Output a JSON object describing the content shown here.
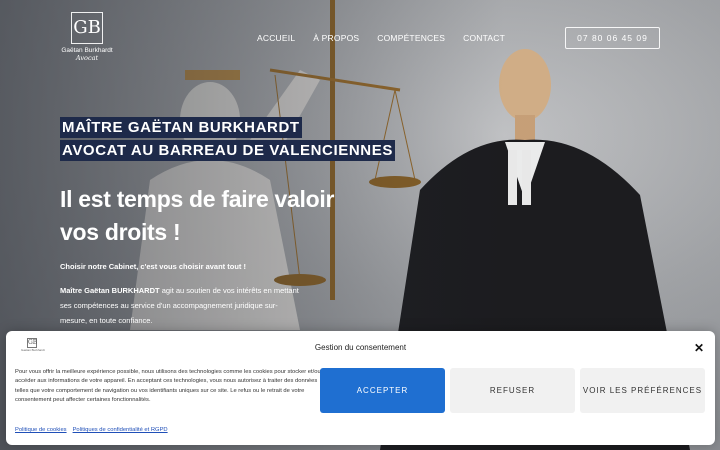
{
  "logo": {
    "monogram": "GB",
    "name": "Gaëtan Burkhardt",
    "subtitle": "Avocat"
  },
  "nav": {
    "items": [
      "ACCUEIL",
      "À PROPOS",
      "COMPÉTENCES",
      "CONTACT"
    ],
    "phone": "07 80 06 45 09"
  },
  "hero": {
    "kicker_line1": "MAÎTRE GAËTAN BURKHARDT",
    "kicker_line2": "AVOCAT AU BARREAU DE VALENCIENNES",
    "headline": "Il est temps de faire valoir vos droits !",
    "tagline": "Choisir notre Cabinet, c'est vous choisir avant tout !",
    "intro_name": "Maître Gaëtan BURKHARDT",
    "intro_rest": " agit au soutien de vos intérêts en mettant ses compétences au service d'un accompagnement juridique sur-mesure, en toute confiance."
  },
  "consent": {
    "title": "Gestion du consentement",
    "text": "Pour vous offrir la meilleure expérience possible, nous utilisons des technologies comme les cookies pour stocker et/ou accéder aux informations de votre appareil. En acceptant ces technologies, vous nous autorisez à traiter des données telles que votre comportement de navigation ou vos identifiants uniques sur ce site. Le refus ou le retrait de votre consentement peut affecter certaines fonctionnalités.",
    "accept": "ACCEPTER",
    "refuse": "REFUSER",
    "preferences": "VOIR LES PRÉFÉRENCES",
    "close": "✕",
    "link_cookies": "Politique de cookies",
    "link_privacy": "Politiques de confidentialité et RGPD",
    "logo_text": "Gaëtan Burkhardt"
  },
  "colors": {
    "kicker_bg": "#1e2a4a",
    "accept_bg": "#1f6fd1",
    "link": "#1f4fb8"
  }
}
